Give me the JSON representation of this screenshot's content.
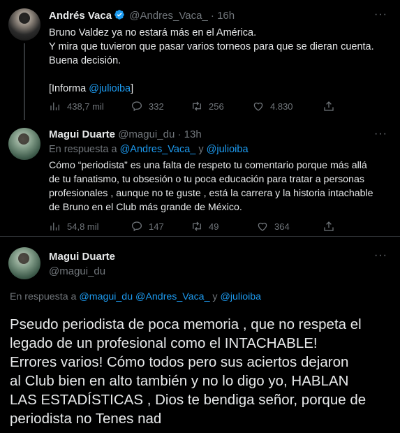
{
  "tweets": [
    {
      "author": "Andrés Vaca",
      "handle": "@Andres_Vaca_",
      "time": "· 16h",
      "verified": true,
      "lines": [
        "Bruno Valdez ya no estará más en el América.",
        "Y mira que tuvieron que pasar varios torneos para que se dieran cuenta.",
        "Buena decisión."
      ],
      "informa_prefix": "[Informa ",
      "informa_mention": "@julioiba",
      "informa_suffix": "]",
      "stats": {
        "views": "438,7 mil",
        "replies": "332",
        "retweets": "256",
        "likes": "4.830"
      }
    },
    {
      "author": "Magui Duarte",
      "handle": "@magui_du",
      "time": "· 13h",
      "reply_prefix": "En respuesta a ",
      "reply_mention1": "@Andres_Vaca_",
      "reply_and": " y ",
      "reply_mention2": "@julioiba",
      "lines": [
        "Cómo “periodista” es una falta de respeto tu comentario porque más allá",
        "de tu fanatismo, tu obsesión o tu poca educación para tratar a personas",
        "profesionales , aunque no te guste , está la carrera y la historia intachable",
        "de Bruno en el Club más grande de México."
      ],
      "stats": {
        "views": "54,8 mil",
        "replies": "147",
        "retweets": "49",
        "likes": "364"
      }
    },
    {
      "author": "Magui Duarte",
      "handle": "@magui_du",
      "reply_prefix": "En respuesta a ",
      "reply_mention1": "@magui_du",
      "reply_mention2": "@Andres_Vaca_",
      "reply_and": " y ",
      "reply_mention3": "@julioiba",
      "lines": [
        "Pseudo periodista de poca memoria , que no respeta el",
        "legado de un profesional como el INTACHABLE!",
        "Errores varios! Cómo todos pero sus aciertos dejaron",
        "al Club bien en alto también y no lo digo yo, HABLAN",
        "LAS ESTADÍSTICAS , Dios te bendiga señor, porque de",
        "periodista no Tenes nad"
      ]
    }
  ],
  "more_glyph": "···",
  "colors": {
    "background": "#000000",
    "text": "#e7e9ea",
    "muted": "#71767b",
    "link": "#1d9bf0"
  }
}
